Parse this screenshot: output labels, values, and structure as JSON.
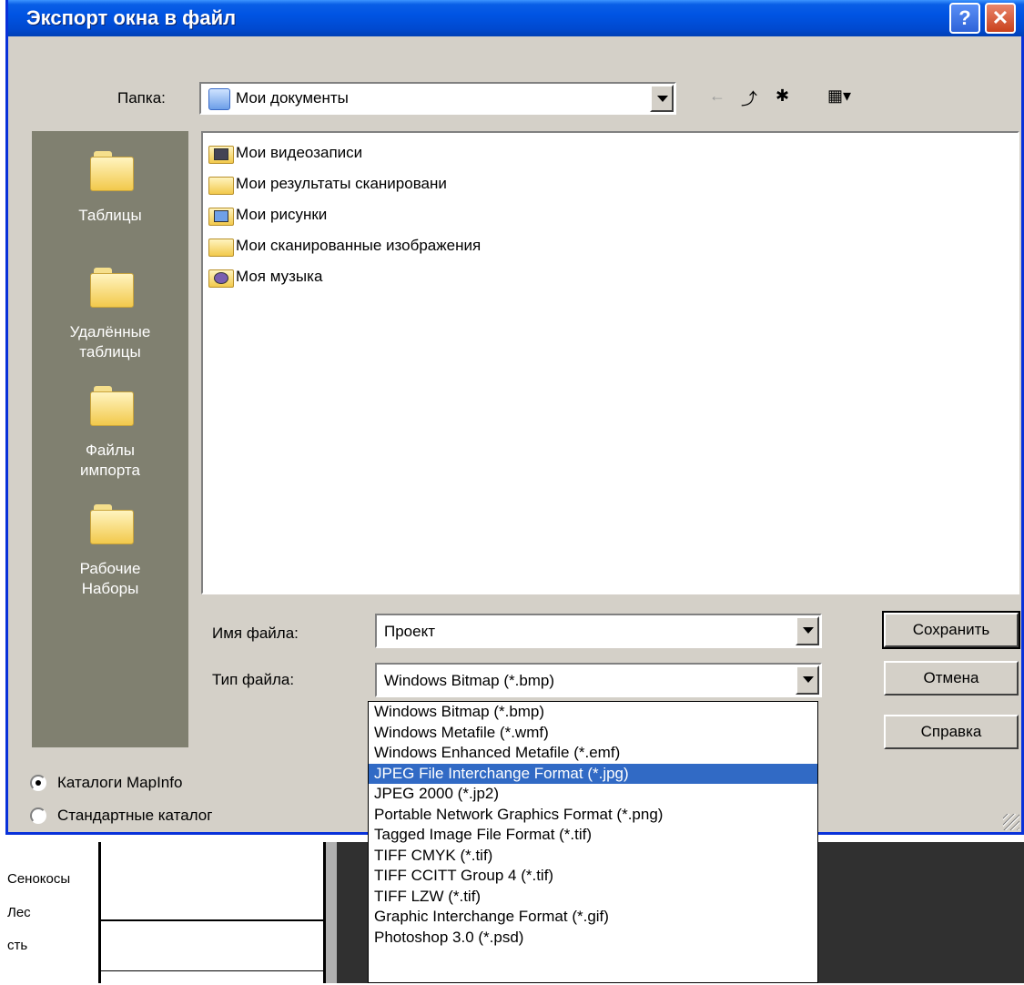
{
  "dialog": {
    "title": "Экспорт окна в файл",
    "help_symbol": "?",
    "close_symbol": "✕"
  },
  "folder_bar": {
    "label": "Папка:",
    "value": "Мои документы",
    "back_icon": "←",
    "up_icon": "⤴",
    "new_folder_icon": "✱",
    "view_icon": "▦▾"
  },
  "sidebar": {
    "items": [
      {
        "label": "Таблицы"
      },
      {
        "label": "Удалённые таблицы"
      },
      {
        "label": "Файлы импорта"
      },
      {
        "label": "Рабочие Наборы"
      }
    ]
  },
  "files": [
    {
      "name": "Мои видеозаписи",
      "icon": "video-folder-icon"
    },
    {
      "name": "Мои результаты сканировани",
      "icon": "folder-icon"
    },
    {
      "name": "Мои рисунки",
      "icon": "pictures-folder-icon"
    },
    {
      "name": "Мои сканированные изображения",
      "icon": "folder-icon"
    },
    {
      "name": "Моя музыка",
      "icon": "music-folder-icon"
    }
  ],
  "filename": {
    "label": "Имя файла:",
    "value": "Проект"
  },
  "filetype": {
    "label": "Тип файла:",
    "value": "Windows Bitmap (*.bmp)",
    "options": [
      "Windows Bitmap (*.bmp)",
      "Windows Metafile (*.wmf)",
      "Windows Enhanced Metafile (*.emf)",
      "JPEG File Interchange Format (*.jpg)",
      "JPEG 2000 (*.jp2)",
      "Portable Network Graphics Format (*.png)",
      "Tagged Image File Format (*.tif)",
      "TIFF CMYK (*.tif)",
      "TIFF CCITT Group 4 (*.tif)",
      "TIFF LZW (*.tif)",
      "Graphic Interchange Format (*.gif)",
      "Photoshop 3.0 (*.psd)"
    ],
    "selected_index": 3
  },
  "buttons": {
    "save": "Сохранить",
    "cancel": "Отмена",
    "help": "Справка"
  },
  "radios": {
    "mapinfo": "Каталоги MapInfo",
    "standard": "Стандартные каталог"
  },
  "background": {
    "labels": [
      "Сенокосы",
      "Лес",
      "сть"
    ]
  },
  "colors": {
    "title_bar": "#0054e3",
    "selection": "#316ac5",
    "dialog_face": "#d4d0c8",
    "sidebar": "#808070"
  }
}
